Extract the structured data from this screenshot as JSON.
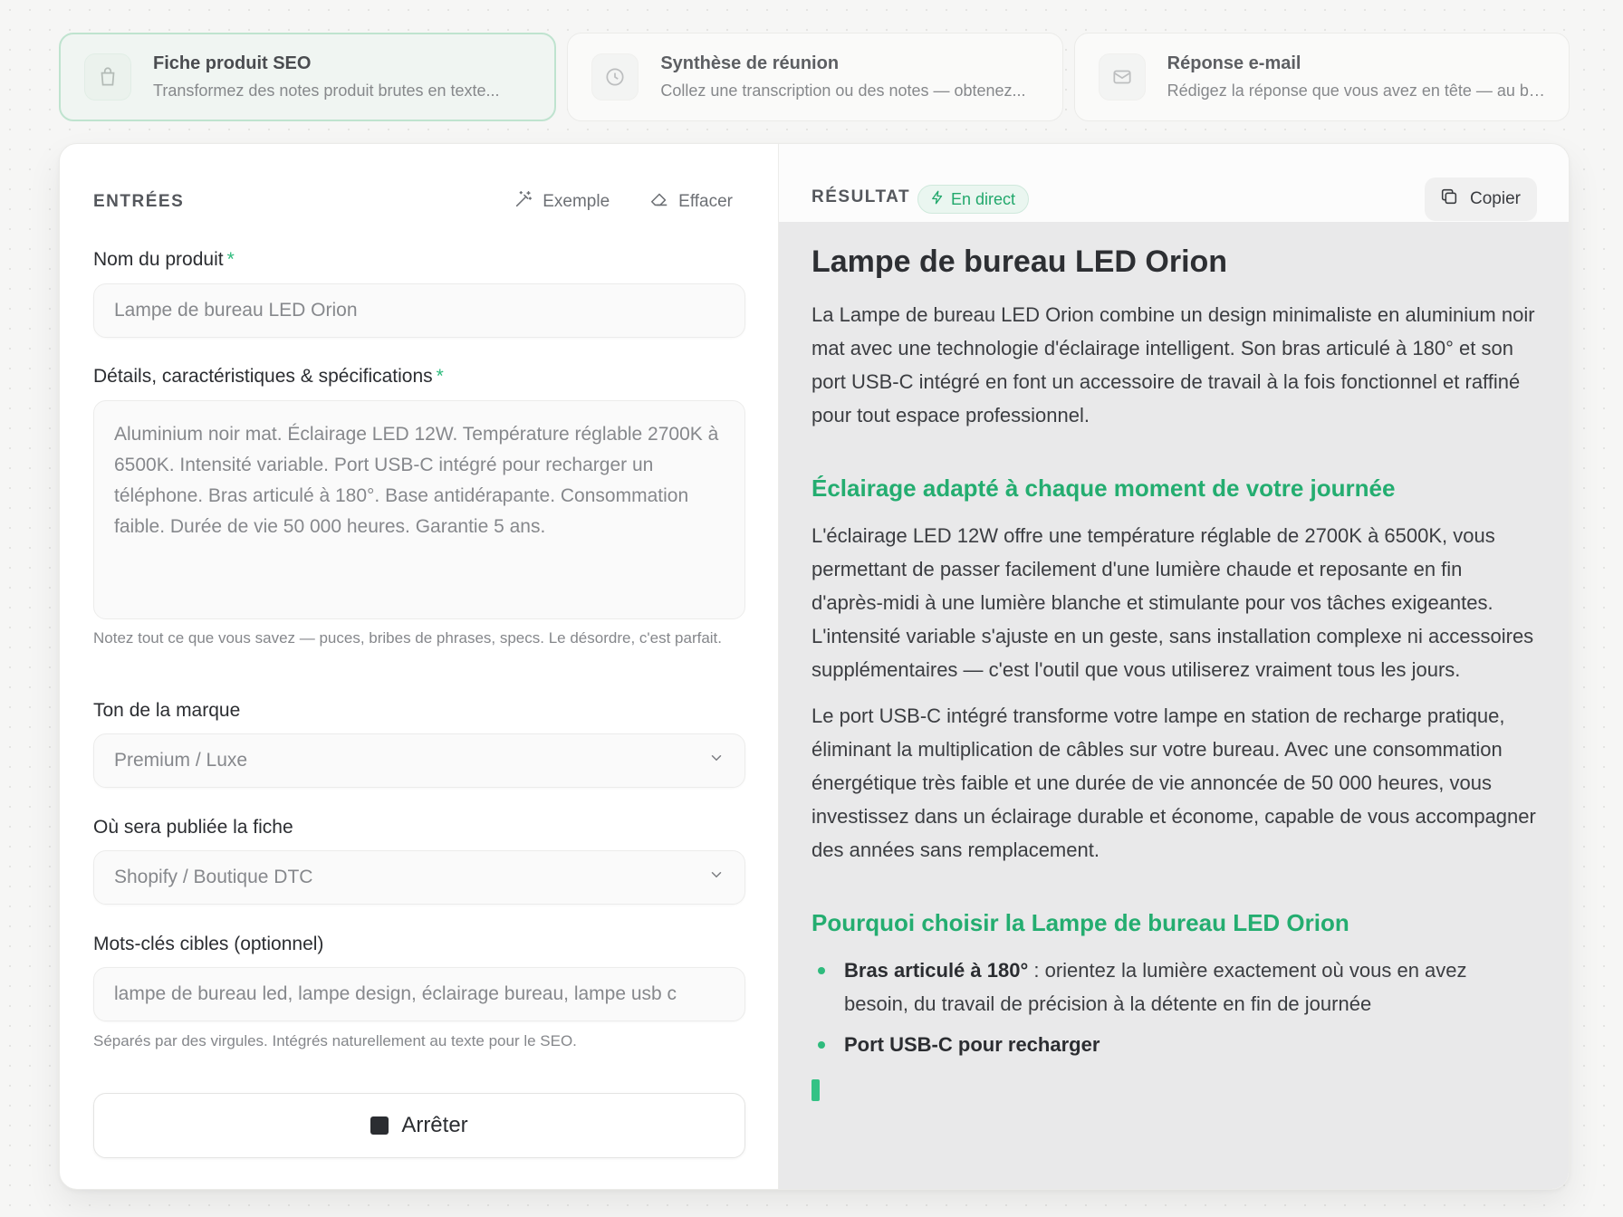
{
  "templates": [
    {
      "title": "Fiche produit SEO",
      "desc": "Transformez des notes produit brutes en texte...",
      "icon": "bag-icon",
      "active": true
    },
    {
      "title": "Synthèse de réunion",
      "desc": "Collez une transcription ou des notes — obtenez...",
      "icon": "clock-icon",
      "active": false
    },
    {
      "title": "Réponse e-mail",
      "desc": "Rédigez la réponse que vous avez en tête — au bo...",
      "icon": "mail-icon",
      "active": false
    }
  ],
  "inputs": {
    "section_title": "ENTRÉES",
    "example_label": "Exemple",
    "clear_label": "Effacer",
    "product_name": {
      "label": "Nom du produit",
      "required": "*",
      "value": "Lampe de bureau LED Orion"
    },
    "details": {
      "label": "Détails, caractéristiques & spécifications",
      "required": "*",
      "value": "Aluminium noir mat. Éclairage LED 12W. Température réglable 2700K à 6500K. Intensité variable. Port USB-C intégré pour recharger un téléphone. Bras articulé à 180°. Base antidérapante. Consommation faible. Durée de vie 50 000 heures. Garantie 5 ans.",
      "hint": "Notez tout ce que vous savez — puces, bribes de phrases, specs. Le désordre, c'est parfait."
    },
    "tone": {
      "label": "Ton de la marque",
      "value": "Premium / Luxe"
    },
    "platform": {
      "label": "Où sera publiée la fiche",
      "value": "Shopify / Boutique DTC"
    },
    "keywords": {
      "label": "Mots-clés cibles (optionnel)",
      "value": "lampe de bureau led, lampe design, éclairage bureau, lampe usb c",
      "hint": "Séparés par des virgules. Intégrés naturellement au texte pour le SEO."
    },
    "stop_label": "Arrêter"
  },
  "result": {
    "section_title": "RÉSULTAT",
    "live_label": "En direct",
    "copy_label": "Copier",
    "title": "Lampe de bureau LED Orion",
    "intro": "La Lampe de bureau LED Orion combine un design minimaliste en aluminium noir mat avec une technologie d'éclairage intelligent. Son bras articulé à 180° et son port USB-C intégré en font un accessoire de travail à la fois fonctionnel et raffiné pour tout espace professionnel.",
    "h2_1": "Éclairage adapté à chaque moment de votre journée",
    "p1": "L'éclairage LED 12W offre une température réglable de 2700K à 6500K, vous permettant de passer facilement d'une lumière chaude et reposante en fin d'après-midi à une lumière blanche et stimulante pour vos tâches exigeantes. L'intensité variable s'ajuste en un geste, sans installation complexe ni accessoires supplémentaires — c'est l'outil que vous utiliserez vraiment tous les jours.",
    "p2": "Le port USB-C intégré transforme votre lampe en station de recharge pratique, éliminant la multiplication de câbles sur votre bureau. Avec une consommation énergétique très faible et une durée de vie annoncée de 50 000 heures, vous investissez dans un éclairage durable et économe, capable de vous accompagner des années sans remplacement.",
    "h2_2": "Pourquoi choisir la Lampe de bureau LED Orion",
    "bullets": [
      {
        "bold": "Bras articulé à 180°",
        "text": " : orientez la lumière exactement où vous en avez besoin, du travail de précision à la détente en fin de journée"
      },
      {
        "bold": "Port USB-C pour recharger",
        "text": ""
      }
    ]
  },
  "colors": {
    "accent": "#2fbb7d",
    "output_bg": "#e9e9ea",
    "active_card_border": "#bfe3cf"
  }
}
